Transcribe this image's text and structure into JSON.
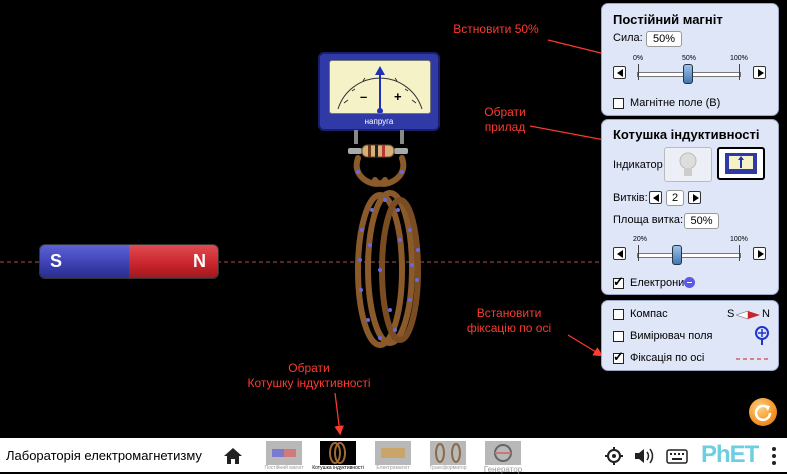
{
  "magnet": {
    "s_label": "S",
    "n_label": "N"
  },
  "meter": {
    "caption": "напруга",
    "minus": "–",
    "plus": "+"
  },
  "magnet_panel": {
    "title": "Постійний магніт",
    "strength_label": "Сила:",
    "strength_value": "50%",
    "ticks": [
      "0%",
      "50%",
      "100%"
    ],
    "field_label": "Магнітне поле (B)"
  },
  "coil_panel": {
    "title": "Котушка індуктивності",
    "indicator_label": "Індикатор",
    "loops_label": "Витків:",
    "loops_value": "2",
    "area_label": "Площа витка:",
    "area_value": "50%",
    "ticks": [
      "20%",
      "100%"
    ],
    "electrons_label": "Електрони"
  },
  "options_panel": {
    "compass_label": "Компас",
    "compass_s": "S",
    "compass_n": "N",
    "meter_label": "Вимірювач поля",
    "axis_label": "Фіксація по осі"
  },
  "annotations": {
    "set50": "Встновити 50%",
    "choose_device_1": "Обрати",
    "choose_device_2": "прилад",
    "fix_axis_1": "Встановити",
    "fix_axis_2": "фіксацію по осі",
    "choose_coil_1": "Обрати",
    "choose_coil_2": "Котушку індуктивності"
  },
  "navbar": {
    "title": "Лабораторія електромагнетизму",
    "tabs": [
      "Постійний магніт",
      "Котушка індуктивності",
      "Електромагніт",
      "Трансформатор",
      "Генератор"
    ],
    "logo": "PhET"
  },
  "colors": {
    "annotation": "#ff3a2f",
    "panel": "#dfe6f7",
    "magnet_s": "#3b3fb0",
    "magnet_n": "#c8232b"
  }
}
